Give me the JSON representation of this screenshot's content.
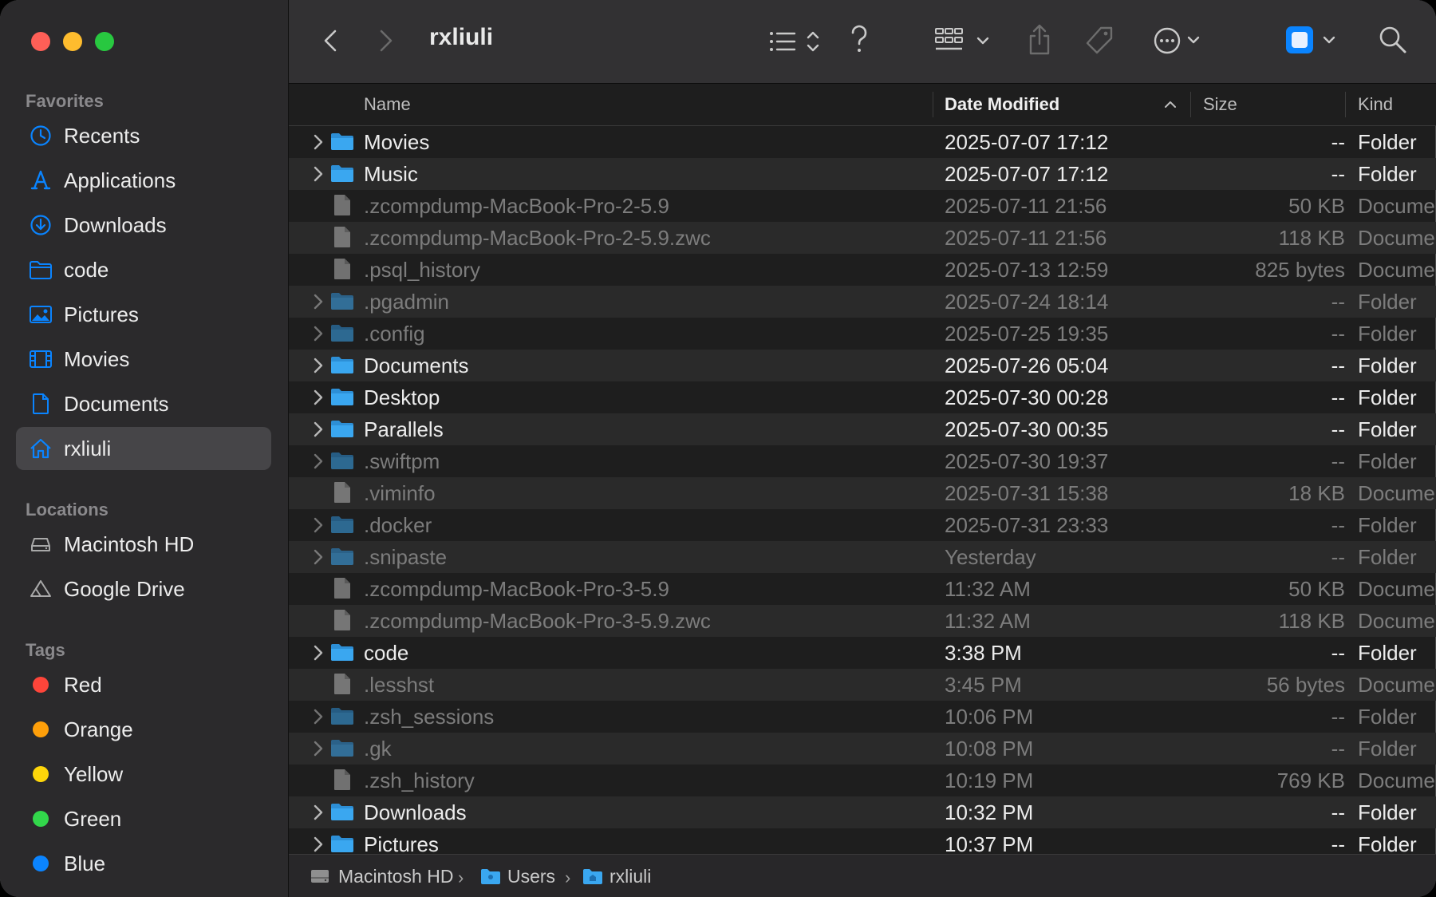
{
  "window": {
    "title": "rxliuli"
  },
  "sidebar": {
    "favorites_label": "Favorites",
    "favorites": [
      {
        "label": "Recents",
        "icon": "clock-icon"
      },
      {
        "label": "Applications",
        "icon": "applications-icon"
      },
      {
        "label": "Downloads",
        "icon": "download-icon"
      },
      {
        "label": "code",
        "icon": "folder-icon"
      },
      {
        "label": "Pictures",
        "icon": "photo-icon"
      },
      {
        "label": "Movies",
        "icon": "film-icon"
      },
      {
        "label": "Documents",
        "icon": "document-icon"
      },
      {
        "label": "rxliuli",
        "icon": "home-icon",
        "selected": true
      }
    ],
    "locations_label": "Locations",
    "locations": [
      {
        "label": "Macintosh HD",
        "icon": "disk-icon"
      },
      {
        "label": "Google Drive",
        "icon": "google-drive-icon"
      }
    ],
    "tags_label": "Tags",
    "tags": [
      {
        "label": "Red",
        "color": "#fe453a"
      },
      {
        "label": "Orange",
        "color": "#fe9f0a"
      },
      {
        "label": "Yellow",
        "color": "#fed60a"
      },
      {
        "label": "Green",
        "color": "#32d74b"
      },
      {
        "label": "Blue",
        "color": "#0b84ff"
      }
    ]
  },
  "toolbar": {
    "title": "rxliuli",
    "buttons": [
      "back-icon",
      "forward-icon",
      "list-view-icon",
      "help-icon",
      "group-icon",
      "share-icon",
      "tag-icon",
      "more-icon",
      "preview-icon",
      "search-icon"
    ]
  },
  "columns": {
    "name": "Name",
    "date": "Date Modified",
    "size": "Size",
    "kind": "Kind",
    "sort": "date-ascending"
  },
  "rows": [
    {
      "name": "Movies",
      "date": "2025-07-07 17:12",
      "size": "--",
      "kind": "Folder",
      "type": "folder",
      "hidden": false
    },
    {
      "name": "Music",
      "date": "2025-07-07 17:12",
      "size": "--",
      "kind": "Folder",
      "type": "folder",
      "hidden": false
    },
    {
      "name": ".zcompdump-MacBook-Pro-2-5.9",
      "date": "2025-07-11 21:56",
      "size": "50 KB",
      "kind": "Docume",
      "type": "file",
      "hidden": true
    },
    {
      "name": ".zcompdump-MacBook-Pro-2-5.9.zwc",
      "date": "2025-07-11 21:56",
      "size": "118 KB",
      "kind": "Docume",
      "type": "file",
      "hidden": true
    },
    {
      "name": ".psql_history",
      "date": "2025-07-13 12:59",
      "size": "825 bytes",
      "kind": "Docume",
      "type": "file",
      "hidden": true
    },
    {
      "name": ".pgadmin",
      "date": "2025-07-24 18:14",
      "size": "--",
      "kind": "Folder",
      "type": "folder",
      "hidden": true
    },
    {
      "name": ".config",
      "date": "2025-07-25 19:35",
      "size": "--",
      "kind": "Folder",
      "type": "folder",
      "hidden": true
    },
    {
      "name": "Documents",
      "date": "2025-07-26 05:04",
      "size": "--",
      "kind": "Folder",
      "type": "folder",
      "hidden": false
    },
    {
      "name": "Desktop",
      "date": "2025-07-30 00:28",
      "size": "--",
      "kind": "Folder",
      "type": "folder",
      "hidden": false
    },
    {
      "name": "Parallels",
      "date": "2025-07-30 00:35",
      "size": "--",
      "kind": "Folder",
      "type": "folder",
      "hidden": false
    },
    {
      "name": ".swiftpm",
      "date": "2025-07-30 19:37",
      "size": "--",
      "kind": "Folder",
      "type": "folder",
      "hidden": true
    },
    {
      "name": ".viminfo",
      "date": "2025-07-31 15:38",
      "size": "18 KB",
      "kind": "Docume",
      "type": "file",
      "hidden": true
    },
    {
      "name": ".docker",
      "date": "2025-07-31 23:33",
      "size": "--",
      "kind": "Folder",
      "type": "folder",
      "hidden": true
    },
    {
      "name": ".snipaste",
      "date": "Yesterday",
      "size": "--",
      "kind": "Folder",
      "type": "folder",
      "hidden": true
    },
    {
      "name": ".zcompdump-MacBook-Pro-3-5.9",
      "date": "11:32 AM",
      "size": "50 KB",
      "kind": "Docume",
      "type": "file",
      "hidden": true
    },
    {
      "name": ".zcompdump-MacBook-Pro-3-5.9.zwc",
      "date": "11:32 AM",
      "size": "118 KB",
      "kind": "Docume",
      "type": "file",
      "hidden": true
    },
    {
      "name": "code",
      "date": "3:38 PM",
      "size": "--",
      "kind": "Folder",
      "type": "folder",
      "hidden": false
    },
    {
      "name": ".lesshst",
      "date": "3:45 PM",
      "size": "56 bytes",
      "kind": "Docume",
      "type": "file",
      "hidden": true
    },
    {
      "name": ".zsh_sessions",
      "date": "10:06 PM",
      "size": "--",
      "kind": "Folder",
      "type": "folder",
      "hidden": true
    },
    {
      "name": ".gk",
      "date": "10:08 PM",
      "size": "--",
      "kind": "Folder",
      "type": "folder",
      "hidden": true
    },
    {
      "name": ".zsh_history",
      "date": "10:19 PM",
      "size": "769 KB",
      "kind": "Docume",
      "type": "file",
      "hidden": true
    },
    {
      "name": "Downloads",
      "date": "10:32 PM",
      "size": "--",
      "kind": "Folder",
      "type": "folder",
      "hidden": false
    },
    {
      "name": "Pictures",
      "date": "10:37 PM",
      "size": "--",
      "kind": "Folder",
      "type": "folder",
      "hidden": false
    }
  ],
  "pathbar": [
    {
      "label": "Macintosh HD",
      "icon": "disk-icon"
    },
    {
      "label": "Users",
      "icon": "folder-icon"
    },
    {
      "label": "rxliuli",
      "icon": "home-folder-icon"
    }
  ],
  "colors": {
    "accent": "#0a84ff",
    "folder": "#3aa7f0"
  }
}
